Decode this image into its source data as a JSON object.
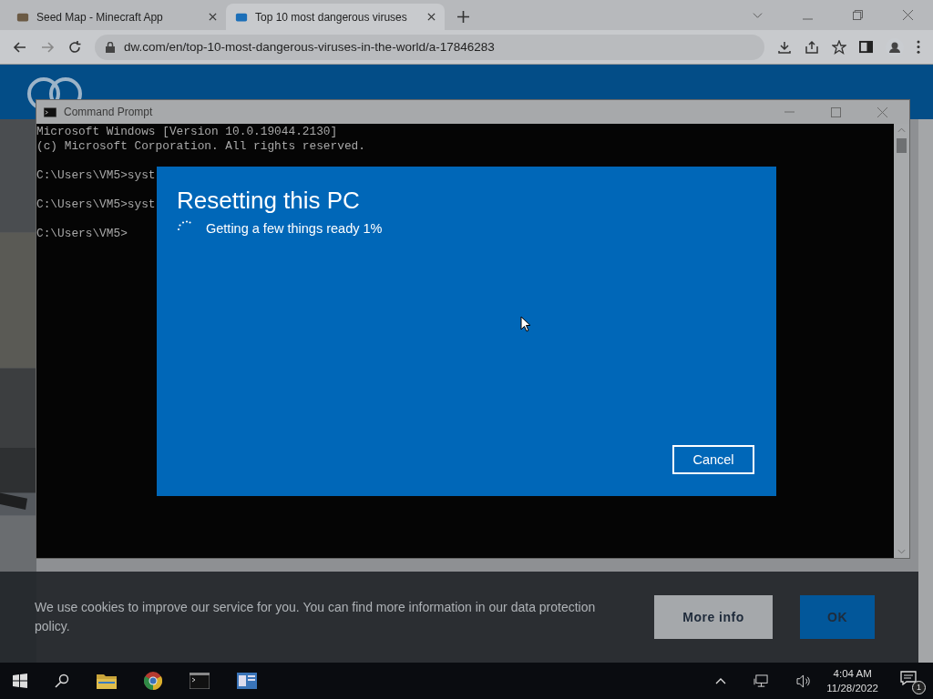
{
  "browser": {
    "tabs": [
      {
        "title": "Seed Map - Minecraft App",
        "selected": false
      },
      {
        "title": "Top 10 most dangerous viruses",
        "selected": true
      }
    ],
    "url": "dw.com/en/top-10-most-dangerous-viruses-in-the-world/a-17846283"
  },
  "cookie_banner": {
    "text": "We use cookies to improve our service for you. You can find more information in our data protection policy.",
    "buttons": [
      {
        "label": "More info",
        "kind": "secondary"
      },
      {
        "label": "OK",
        "kind": "primary"
      }
    ]
  },
  "command_prompt": {
    "title": "Command Prompt",
    "lines": [
      {
        "text": "Microsoft Windows [Version 10.0.19044.2130]",
        "kind": "output"
      },
      {
        "text": "(c) Microsoft Corporation. All rights reserved.",
        "kind": "output"
      },
      {
        "text": "C:\\Users\\VM5>syst",
        "kind": "prompt"
      },
      {
        "text": "C:\\Users\\VM5>syst",
        "kind": "prompt"
      },
      {
        "text": "C:\\Users\\VM5>",
        "kind": "prompt"
      }
    ]
  },
  "dialog": {
    "title": "Resetting this PC",
    "status": "Getting a few things ready 1%",
    "button": "Cancel"
  },
  "taskbar": {
    "time": "4:04 AM",
    "date": "11/28/2022",
    "notifications": "1"
  }
}
